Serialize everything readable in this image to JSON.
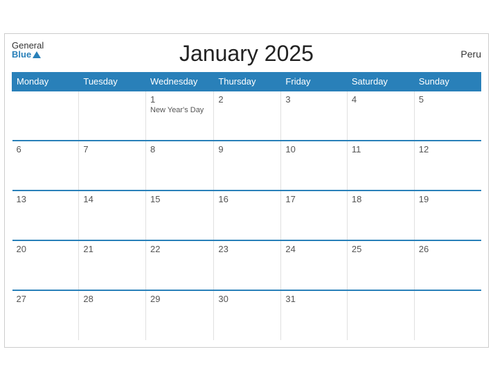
{
  "header": {
    "title": "January 2025",
    "country": "Peru",
    "logo": {
      "general": "General",
      "blue": "Blue"
    }
  },
  "days_of_week": [
    "Monday",
    "Tuesday",
    "Wednesday",
    "Thursday",
    "Friday",
    "Saturday",
    "Sunday"
  ],
  "weeks": [
    [
      {
        "day": "",
        "empty": true
      },
      {
        "day": "",
        "empty": true
      },
      {
        "day": "1",
        "holiday": "New Year's Day"
      },
      {
        "day": "2"
      },
      {
        "day": "3"
      },
      {
        "day": "4"
      },
      {
        "day": "5"
      }
    ],
    [
      {
        "day": "6"
      },
      {
        "day": "7"
      },
      {
        "day": "8"
      },
      {
        "day": "9"
      },
      {
        "day": "10"
      },
      {
        "day": "11"
      },
      {
        "day": "12"
      }
    ],
    [
      {
        "day": "13"
      },
      {
        "day": "14"
      },
      {
        "day": "15"
      },
      {
        "day": "16"
      },
      {
        "day": "17"
      },
      {
        "day": "18"
      },
      {
        "day": "19"
      }
    ],
    [
      {
        "day": "20"
      },
      {
        "day": "21"
      },
      {
        "day": "22"
      },
      {
        "day": "23"
      },
      {
        "day": "24"
      },
      {
        "day": "25"
      },
      {
        "day": "26"
      }
    ],
    [
      {
        "day": "27"
      },
      {
        "day": "28"
      },
      {
        "day": "29"
      },
      {
        "day": "30"
      },
      {
        "day": "31"
      },
      {
        "day": "",
        "empty": true
      },
      {
        "day": "",
        "empty": true
      }
    ]
  ]
}
